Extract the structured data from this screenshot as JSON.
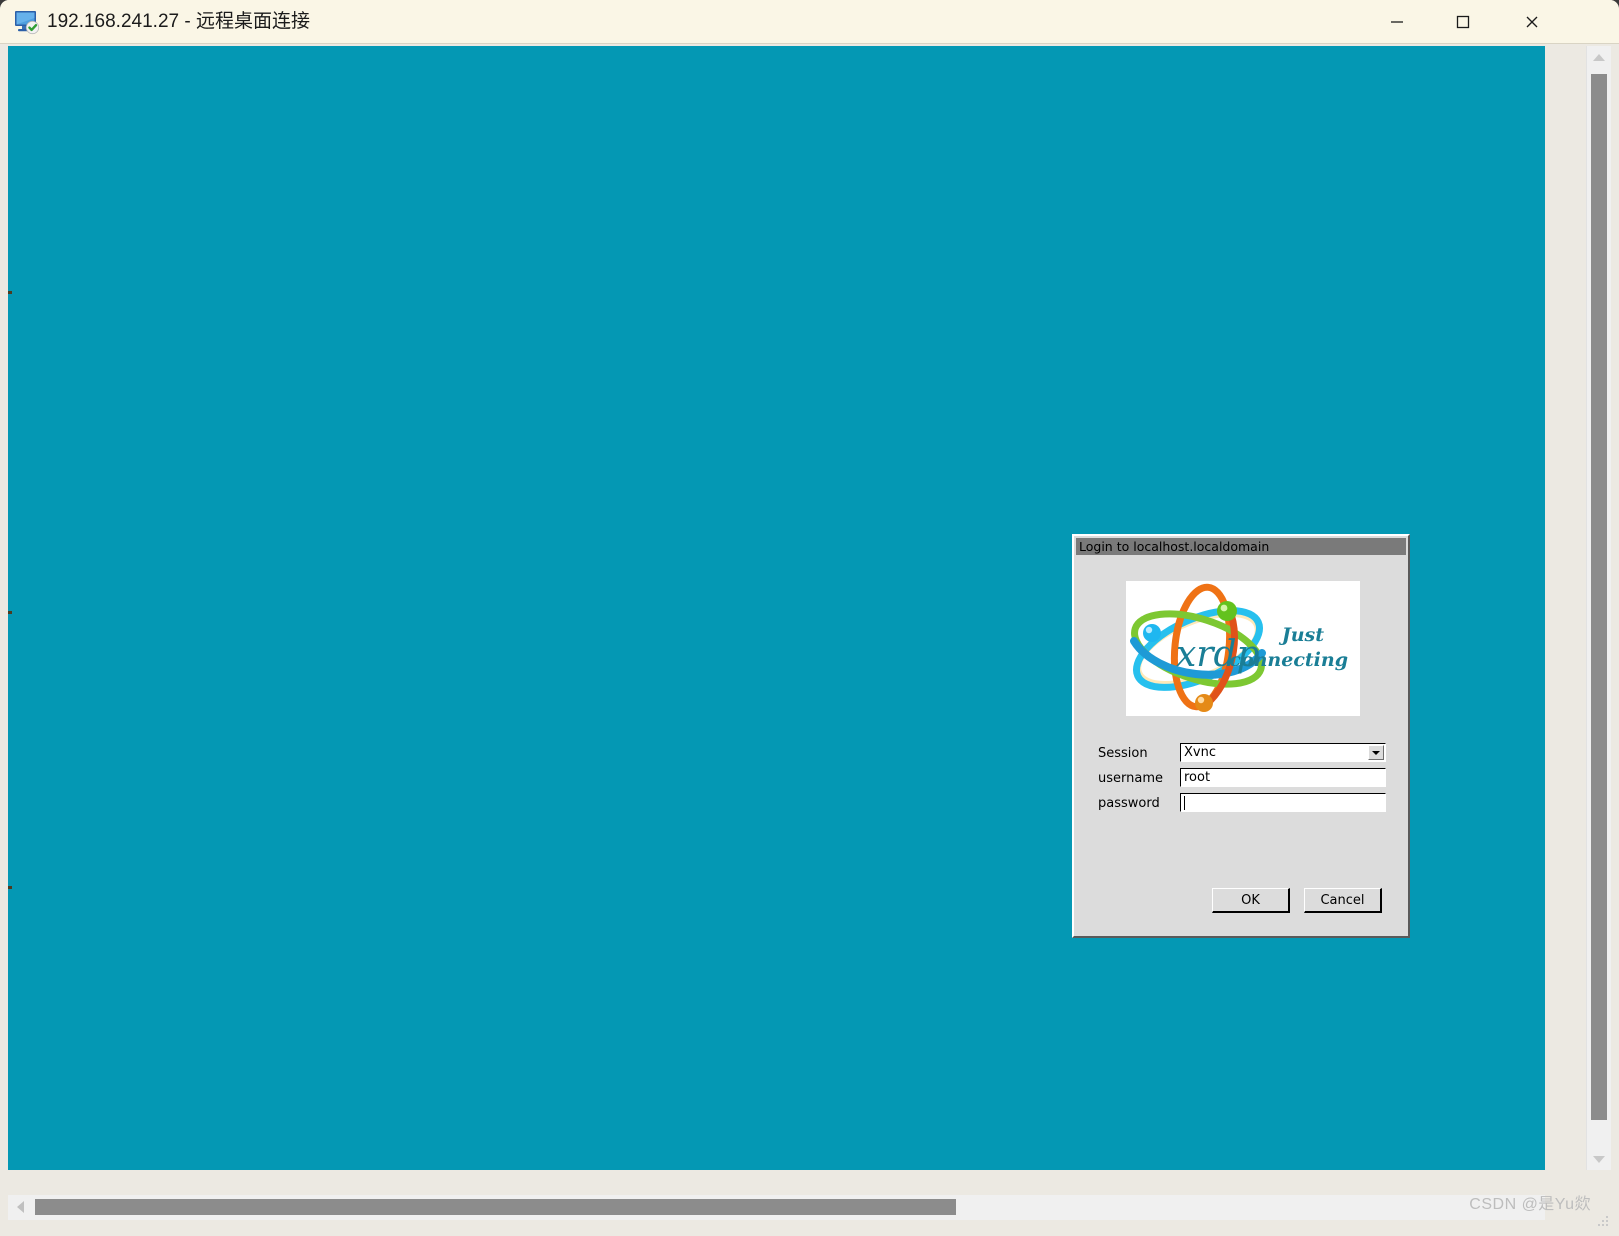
{
  "window": {
    "title": "192.168.241.27 - 远程桌面连接",
    "icon": "remote-desktop-icon",
    "controls": {
      "minimize": "—",
      "maximize": "□",
      "close": "✕"
    },
    "titlebar_color": "#faf6e6",
    "desktop_color": "#0498b4"
  },
  "scrollbars": {
    "vertical": {
      "up_arrow": "▲",
      "down_arrow": "▼"
    },
    "horizontal": {
      "left_arrow": "◀"
    }
  },
  "dialog": {
    "title": "Login to localhost.localdomain",
    "titlebar_color": "#7a7a7a",
    "background_color": "#dcdcdc",
    "logo": {
      "wordmark": "xrdp",
      "tagline_line1": "Just",
      "tagline_line2": "connecting",
      "tagline_color": "#1a7e96"
    },
    "fields": [
      {
        "label": "Session",
        "value": "Xvnc",
        "type": "combobox"
      },
      {
        "label": "username",
        "value": "root",
        "type": "text"
      },
      {
        "label": "password",
        "value": "",
        "type": "password"
      }
    ],
    "buttons": {
      "ok": "OK",
      "cancel": "Cancel"
    }
  },
  "watermark": {
    "text": "CSDN @是Yu欻"
  }
}
